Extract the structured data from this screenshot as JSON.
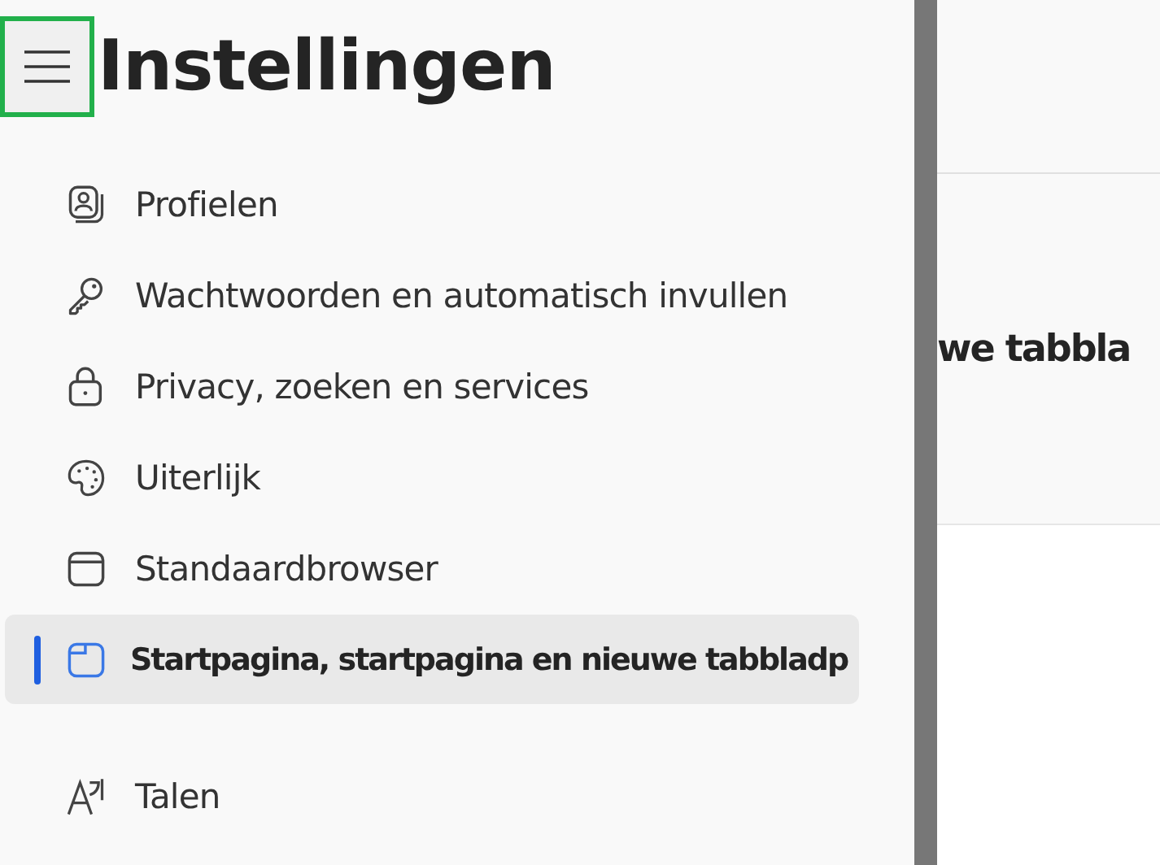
{
  "header": {
    "title": "Instellingen",
    "menu_button_focused": true
  },
  "sidebar": {
    "groups": [
      {
        "items": [
          {
            "label": "Profielen",
            "selected": false
          },
          {
            "label": "Wachtwoorden en automatisch invullen",
            "selected": false
          },
          {
            "label": "Privacy, zoeken en services",
            "selected": false
          },
          {
            "label": "Uiterlijk",
            "selected": false
          },
          {
            "label": "Standaardbrowser",
            "selected": false
          },
          {
            "label": "Startpagina, startpagina en nieuwe tabbladp",
            "selected": true
          }
        ]
      },
      {
        "items": [
          {
            "label": "Talen",
            "selected": false
          }
        ]
      }
    ]
  },
  "content": {
    "heading": "we tabbla"
  }
}
